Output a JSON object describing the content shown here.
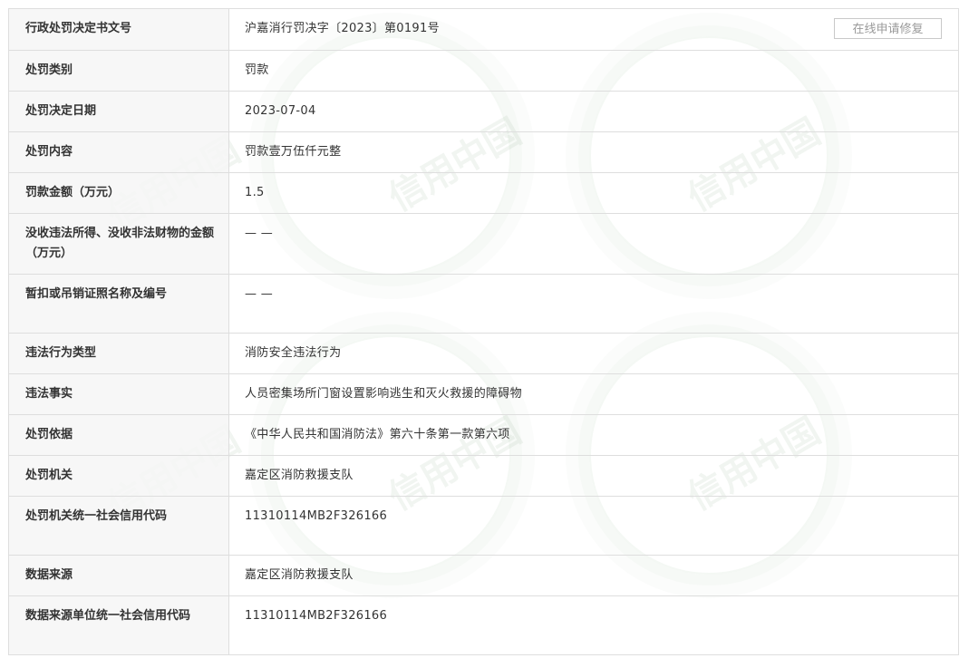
{
  "actions": {
    "repair_button": "在线申请修复"
  },
  "watermark": {
    "text": "信用中国"
  },
  "rows": [
    {
      "label": "行政处罚决定书文号",
      "value": "沪嘉消行罚决字〔2023〕第0191号"
    },
    {
      "label": "处罚类别",
      "value": "罚款"
    },
    {
      "label": "处罚决定日期",
      "value": "2023-07-04"
    },
    {
      "label": "处罚内容",
      "value": "罚款壹万伍仟元整"
    },
    {
      "label": "罚款金额（万元）",
      "value": "1.5"
    },
    {
      "label": "没收违法所得、没收非法财物的金额（万元）",
      "value": "— —"
    },
    {
      "label": "暂扣或吊销证照名称及编号",
      "value": "— —"
    },
    {
      "label": "违法行为类型",
      "value": "消防安全违法行为"
    },
    {
      "label": "违法事实",
      "value": "人员密集场所门窗设置影响逃生和灭火救援的障碍物"
    },
    {
      "label": "处罚依据",
      "value": "《中华人民共和国消防法》第六十条第一款第六项"
    },
    {
      "label": "处罚机关",
      "value": "嘉定区消防救援支队"
    },
    {
      "label": "处罚机关统一社会信用代码",
      "value": "11310114MB2F326166"
    },
    {
      "label": "数据来源",
      "value": "嘉定区消防救援支队"
    },
    {
      "label": "数据来源单位统一社会信用代码",
      "value": "11310114MB2F326166"
    }
  ]
}
